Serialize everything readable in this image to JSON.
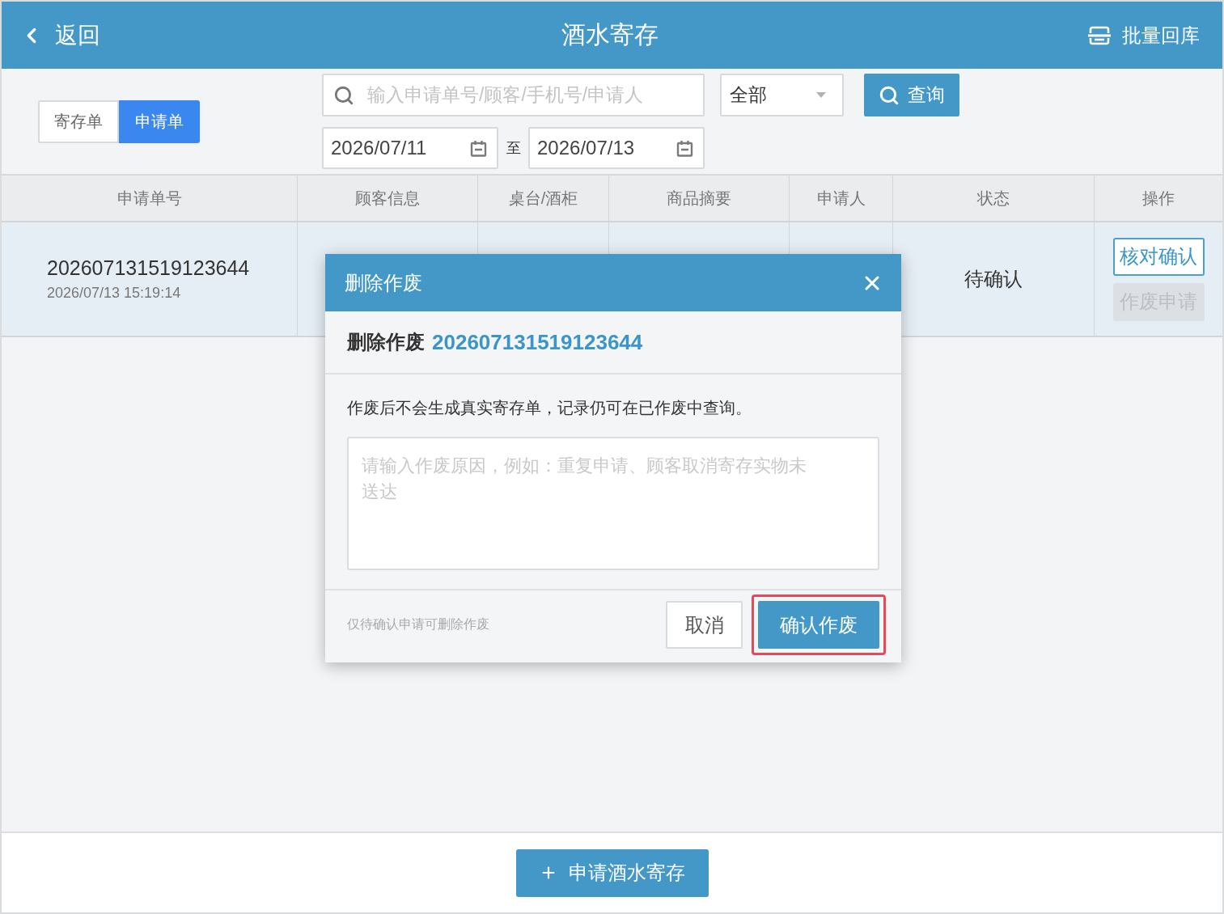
{
  "header": {
    "back_label": "返回",
    "title": "酒水寄存",
    "action_label": "批量回库"
  },
  "filters": {
    "tabs": [
      {
        "label": "寄存单",
        "selected": false
      },
      {
        "label": "申请单",
        "selected": true
      }
    ],
    "search": {
      "placeholder": "输入申请单号/顾客/手机号/申请人"
    },
    "status_select": {
      "value": "全部"
    },
    "query_button": "查询",
    "date_from": "2026/07/11",
    "date_separator": "至",
    "date_to": "2026/07/13"
  },
  "table": {
    "columns": [
      "申请单号",
      "顾客信息",
      "桌台/酒柜",
      "商品摘要",
      "申请人",
      "状态",
      "操作"
    ],
    "rows": [
      {
        "selected": true,
        "order_no": "202607131519123644",
        "created_at": "2026/07/13 15:19:14",
        "status": "待确认",
        "actions": [
          {
            "label": "核对确认",
            "disabled": false
          },
          {
            "label": "作废申请",
            "disabled": true
          }
        ]
      }
    ]
  },
  "dialog": {
    "title": "删除作废",
    "subject_label": "删除作废",
    "subject_number": "202607131519123644",
    "notice": "作废后不会生成真实寄存单，记录仍可在已作废中查询。",
    "reason": {
      "placeholder": "请输入作废原因，例如：重复申请、顾客取消寄存实物未送达"
    },
    "hint": "仅待确认申请可删除作废",
    "buttons": [
      {
        "label": "取消",
        "kind": "secondary",
        "highlighted": false
      },
      {
        "label": "确认作废",
        "kind": "primary",
        "highlighted": true
      }
    ]
  },
  "footer": {
    "add_button": "申请酒水寄存"
  }
}
